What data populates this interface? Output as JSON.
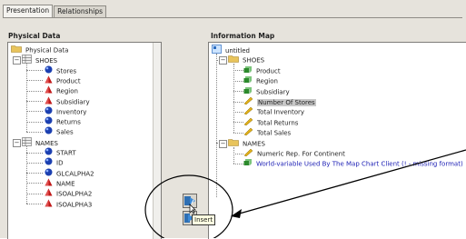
{
  "tabs": [
    {
      "label": "Presentation",
      "active": true
    },
    {
      "label": "Relationships",
      "active": false
    }
  ],
  "left_panel": {
    "title": "Physical Data",
    "root": "Physical Data",
    "tables": [
      {
        "name": "SHOES",
        "items": [
          {
            "label": "Stores",
            "icon": "measure-blue-sphere-icon"
          },
          {
            "label": "Product",
            "icon": "category-red-cone-icon"
          },
          {
            "label": "Region",
            "icon": "category-red-cone-icon"
          },
          {
            "label": "Subsidiary",
            "icon": "category-red-cone-icon"
          },
          {
            "label": "Inventory",
            "icon": "measure-blue-sphere-icon"
          },
          {
            "label": "Returns",
            "icon": "measure-blue-sphere-icon"
          },
          {
            "label": "Sales",
            "icon": "measure-blue-sphere-icon"
          }
        ]
      },
      {
        "name": "NAMES",
        "items": [
          {
            "label": "START",
            "icon": "measure-blue-sphere-icon"
          },
          {
            "label": "ID",
            "icon": "measure-blue-sphere-icon"
          },
          {
            "label": "GLCALPHA2",
            "icon": "measure-blue-sphere-icon"
          },
          {
            "label": "NAME",
            "icon": "category-red-cone-icon"
          },
          {
            "label": "ISOALPHA2",
            "icon": "category-red-cone-icon"
          },
          {
            "label": "ISOALPHA3",
            "icon": "category-red-cone-icon"
          }
        ]
      }
    ]
  },
  "right_panel": {
    "title": "Information Map",
    "root": "untitled",
    "folders": [
      {
        "name": "SHOES",
        "items": [
          {
            "label": "Product",
            "icon": "category-green-item-icon"
          },
          {
            "label": "Region",
            "icon": "category-green-item-icon"
          },
          {
            "label": "Subsidiary",
            "icon": "category-green-item-icon"
          },
          {
            "label": "Number Of Stores",
            "icon": "measure-ruler-icon",
            "selected": true
          },
          {
            "label": "Total Inventory",
            "icon": "measure-ruler-icon"
          },
          {
            "label": "Total Returns",
            "icon": "measure-ruler-icon"
          },
          {
            "label": "Total Sales",
            "icon": "measure-ruler-icon"
          }
        ]
      },
      {
        "name": "NAMES",
        "items": [
          {
            "label": "Numeric Rep. For Continent",
            "icon": "measure-ruler-icon"
          },
          {
            "label": "World-variable Used By The Map Chart Client (! - missing format)",
            "icon": "category-green-item-icon",
            "blue": true
          }
        ]
      }
    ]
  },
  "toolbar": {
    "tooltip": "Insert"
  },
  "colors": {
    "highlight": "#c8c8c8",
    "blue_text": "#1f22b6",
    "panel_bg": "#ffffff",
    "window_bg": "#e6e3dc"
  }
}
